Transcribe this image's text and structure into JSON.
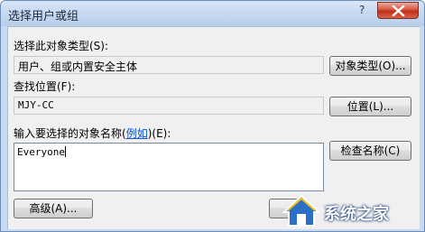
{
  "window": {
    "title": "选择用户或组",
    "help_glyph": "?",
    "close_icon": "close-x-icon"
  },
  "object_type": {
    "label": "选择此对象类型(S):",
    "value": "用户、组或内置安全主体",
    "button": "对象类型(O)..."
  },
  "location": {
    "label": "查找位置(F):",
    "value": "MJY-CC",
    "button": "位置(L)..."
  },
  "names": {
    "label_prefix": "输入要选择的对象名称(",
    "label_link": "例如",
    "label_suffix": ")(E):",
    "value": "Everyone",
    "check_button": "检查名称(C)"
  },
  "footer": {
    "advanced_button": "高级(A)..."
  },
  "watermark": {
    "text": "系统之家",
    "logo_icon": "house-logo-icon"
  },
  "colors": {
    "title_bar": "#c6d9f1",
    "close_button": "#c22f18",
    "dialog_bg": "#f0f0f0",
    "link": "#1155cc"
  }
}
